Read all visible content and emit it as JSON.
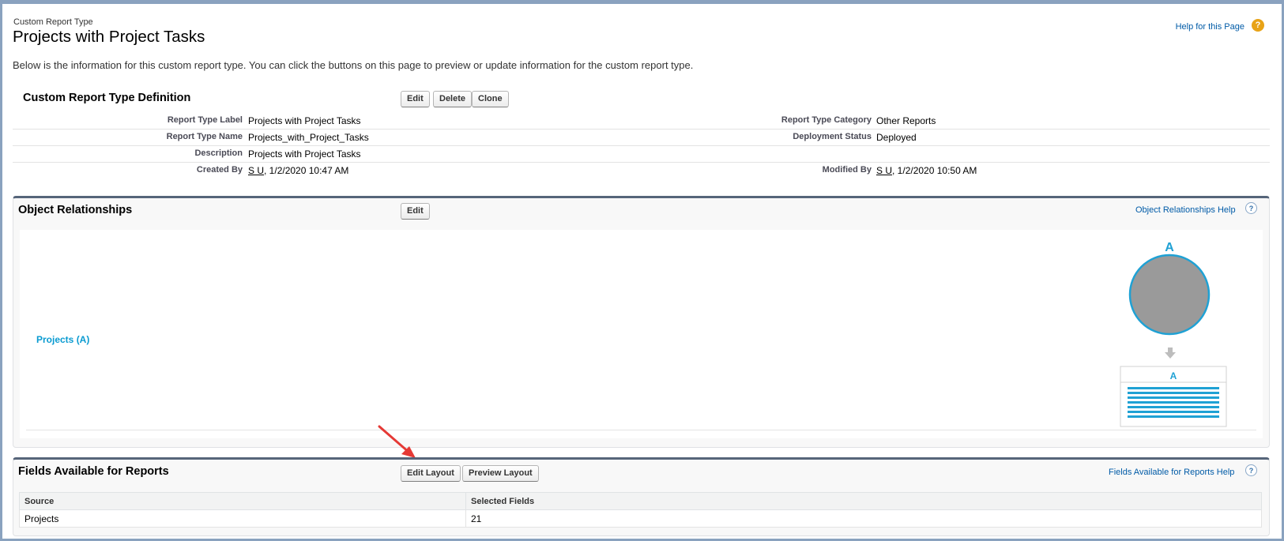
{
  "page": {
    "type_label": "Custom Report Type",
    "title": "Projects with Project Tasks",
    "help_link": "Help for this Page",
    "help_badge": "?",
    "intro": "Below is the information for this custom report type. You can click the buttons on this page to preview or update information for the custom report type."
  },
  "definition": {
    "title": "Custom Report Type Definition",
    "buttons": {
      "edit": "Edit",
      "delete": "Delete",
      "clone": "Clone"
    },
    "rows": [
      {
        "label": "Report Type Label",
        "value": "Projects with Project Tasks",
        "label2": "Report Type Category",
        "value2": "Other Reports"
      },
      {
        "label": "Report Type Name",
        "value": "Projects_with_Project_Tasks",
        "label2": "Deployment Status",
        "value2": "Deployed"
      },
      {
        "label": "Description",
        "value": "Projects with Project Tasks",
        "label2": "",
        "value2": ""
      },
      {
        "label": "Created By",
        "user": "S U",
        "value": ", 1/2/2020 10:47 AM",
        "label2": "Modified By",
        "user2": "S U",
        "value2": ", 1/2/2020 10:50 AM"
      }
    ]
  },
  "relationships": {
    "title": "Object Relationships",
    "edit_button": "Edit",
    "help_link": "Object Relationships Help",
    "help_icon": "?",
    "object_link": "Projects (A)",
    "diagram_label_circle": "A",
    "diagram_label_table": "A",
    "arrow_icon": "down-arrow-icon"
  },
  "fields": {
    "title": "Fields Available for Reports",
    "edit_layout_button": "Edit Layout",
    "preview_layout_button": "Preview Layout",
    "help_link": "Fields Available for Reports Help",
    "help_icon": "?",
    "columns": [
      "Source",
      "Selected Fields"
    ],
    "rows": [
      {
        "source": "Projects",
        "selected": "21"
      }
    ]
  },
  "colors": {
    "accent_link": "#015ba7",
    "object_link": "#0a9bd1",
    "section_bar": "#56657a",
    "annotation_arrow": "#e53935",
    "circle_fill": "#9a9a9a",
    "circle_stroke": "#1fa1d4"
  }
}
